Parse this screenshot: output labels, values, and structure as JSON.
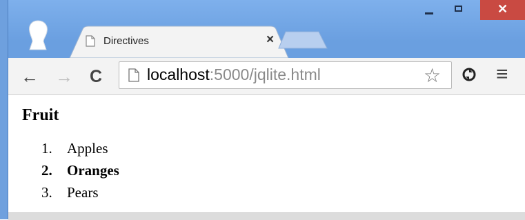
{
  "window": {
    "minimize_glyph": "–",
    "close_glyph": "✕"
  },
  "tab": {
    "title": "Directives",
    "close_glyph": "×"
  },
  "toolbar": {
    "back_glyph": "←",
    "forward_glyph": "→",
    "reload_glyph": "C",
    "url_host": "localhost",
    "url_rest": ":5000/jqlite.html",
    "star_glyph": "☆",
    "menu_glyph": "≡"
  },
  "page": {
    "heading": "Fruit",
    "items": [
      {
        "number": "1.",
        "label": "Apples",
        "bold": false
      },
      {
        "number": "2.",
        "label": "Oranges",
        "bold": true
      },
      {
        "number": "3.",
        "label": "Pears",
        "bold": false
      }
    ]
  },
  "colors": {
    "frame": "#6ea0de",
    "close_button": "#c94a42",
    "toolbar": "#f3f3f3"
  },
  "icons": [
    "profile-icon",
    "page-icon",
    "star-icon",
    "extension-icon",
    "menu-icon"
  ]
}
